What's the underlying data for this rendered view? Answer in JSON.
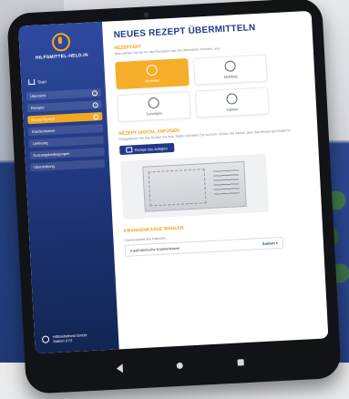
{
  "app": {
    "name": "HILFSMITTEL-HELD.IN"
  },
  "sidebar": {
    "start_label": "Start",
    "items": [
      {
        "label": "Übersicht",
        "check": "✓",
        "active": false
      },
      {
        "label": "Rezepte",
        "check": "✓",
        "active": false
      },
      {
        "label": "Neues Rezept",
        "check": "✓",
        "active": true
      },
      {
        "label": "Krankenkasse",
        "check": "",
        "active": false
      },
      {
        "label": "Lieferung",
        "check": "",
        "active": false
      },
      {
        "label": "Nutzungsbedingungen",
        "check": "",
        "active": false
      },
      {
        "label": "Übermittlung",
        "check": "",
        "active": false
      }
    ],
    "company": {
      "name": "Hilfsmittelheld GmbH",
      "sub": "Station XYZ"
    }
  },
  "main": {
    "title": "NEUES REZEPT ÜBERMITTELN",
    "category": {
      "label": "REZEPTART",
      "hint": "Bitte wählen Sie die Art des Rezeptes, das Sie übermitteln möchten, aus.",
      "tiles": [
        {
          "label": "Hörhilfen",
          "icon": "ear-icon",
          "active": true
        },
        {
          "label": "Mobilität",
          "icon": "wheelchair-icon",
          "active": false
        },
        {
          "label": "Sonstiges",
          "icon": "gear-icon",
          "active": false
        },
        {
          "label": "Optiker",
          "icon": "eye-icon",
          "active": false
        }
      ]
    },
    "upload": {
      "label": "REZEPT DIGITAL ANFÜGEN",
      "hint": "Fotografieren Sie das Rezept mit dem Tablet und laden Sie es hoch. Achten Sie darauf, dass das Rezept gut lesbar ist.",
      "button": "Rezept neu anfügen"
    },
    "insurance": {
      "label": "KRANKENKASSE WÄHLEN",
      "field_label": "Krankenkasse des Patienten",
      "value": "Kaufmännische Krankenkasse",
      "action": "Ändern ▾"
    }
  },
  "colors": {
    "accent": "#f4a820",
    "primary": "#1f3a8a"
  }
}
